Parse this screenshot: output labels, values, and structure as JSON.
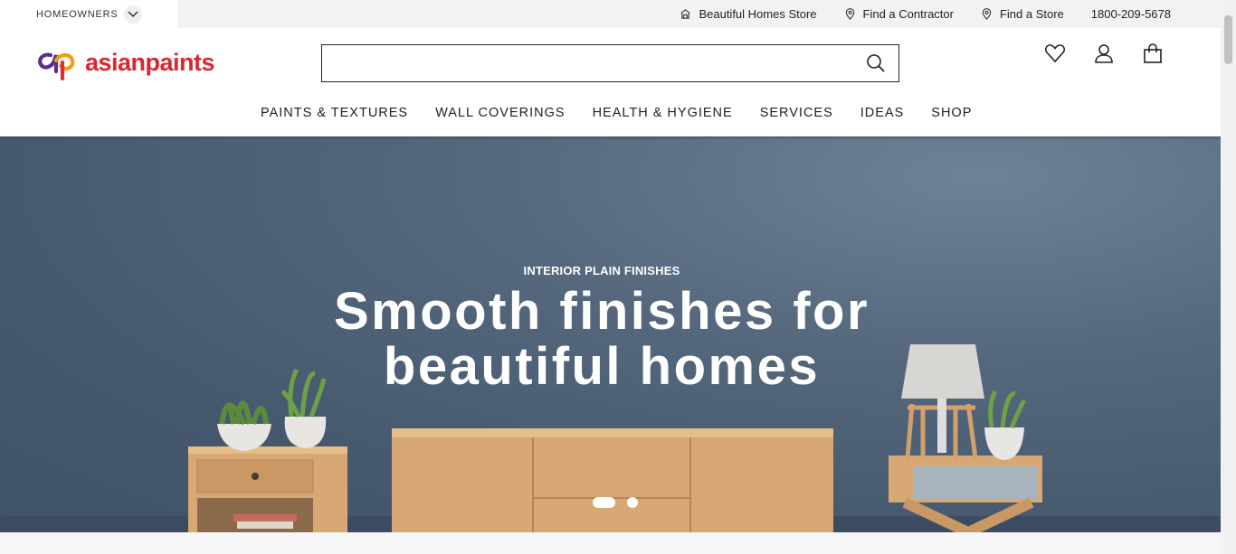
{
  "topbar": {
    "audience_label": "HOMEOWNERS",
    "links": [
      {
        "label": "Beautiful Homes Store",
        "icon": "store-icon"
      },
      {
        "label": "Find a Contractor",
        "icon": "location-pin-icon"
      },
      {
        "label": "Find a Store",
        "icon": "location-pin-icon"
      }
    ],
    "phone": "1800-209-5678"
  },
  "header": {
    "brand": "asianpaints",
    "search": {
      "value": "",
      "placeholder": ""
    },
    "nav": [
      "PAINTS & TEXTURES",
      "WALL COVERINGS",
      "HEALTH & HYGIENE",
      "SERVICES",
      "IDEAS",
      "SHOP"
    ],
    "icons": [
      "wishlist-heart-icon",
      "account-user-icon",
      "cart-bag-icon"
    ]
  },
  "hero": {
    "eyebrow": "INTERIOR PLAIN FINISHES",
    "headline_line1": "Smooth finishes for",
    "headline_line2": "beautiful homes",
    "slides_total": 2,
    "active_slide": 1
  },
  "colors": {
    "brand_red": "#d9272e",
    "hero_wall": "#4a5d73"
  }
}
